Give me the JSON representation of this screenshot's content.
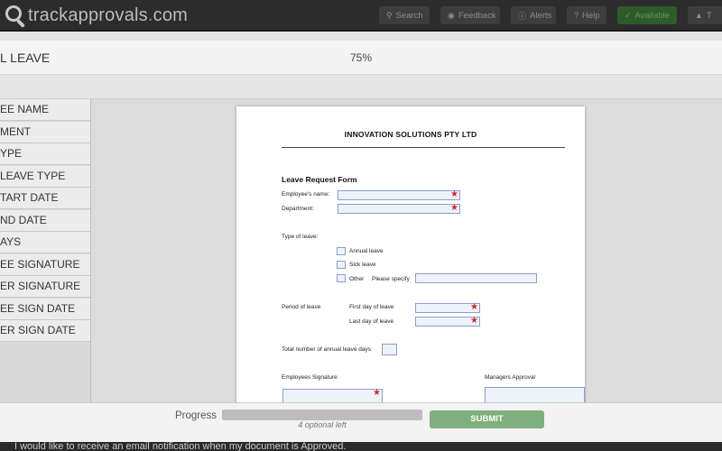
{
  "header": {
    "logo_text": "trackapprovals",
    "logo_suffix": ".com",
    "nav": [
      {
        "label": "Search",
        "icon": "search-icon"
      },
      {
        "label": "Feedback",
        "icon": "chat-icon"
      },
      {
        "label": "Alerts",
        "icon": "info-icon"
      },
      {
        "label": "Help",
        "icon": "help-icon"
      },
      {
        "label": "Available",
        "icon": "check-icon"
      },
      {
        "label": "T",
        "icon": "user-icon"
      }
    ]
  },
  "titlebar": {
    "title": "L LEAVE",
    "zoom": "75%"
  },
  "sidebar": {
    "items": [
      "EE NAME",
      "MENT",
      "YPE",
      "LEAVE TYPE",
      "TART DATE",
      "ND DATE",
      "AYS",
      "EE SIGNATURE",
      "ER SIGNATURE",
      "EE SIGN DATE",
      "ER SIGN DATE"
    ]
  },
  "document": {
    "company": "INNOVATION SOLUTIONS PTY LTD",
    "form_title": "Leave Request Form",
    "employee_name_label": "Employee's name:",
    "department_label": "Department:",
    "type_of_leave_label": "Type of leave:",
    "annual_leave": "Annual leave",
    "sick_leave": "Sick leave",
    "other": "Other",
    "please_specify": "Please specify",
    "period_label": "Period of leave",
    "first_day_label": "First day of leave",
    "last_day_label": "Last day of leave",
    "total_days_label": "Total number of annual leave days",
    "employee_signature_label": "Employees Signature",
    "managers_approval_label": "Managers Approval",
    "required_marker": "★"
  },
  "bottom": {
    "progress_label": "Progress",
    "progress_value": 0,
    "optional_left": "4 optional left",
    "submit_label": "SUBMIT",
    "notification_text": "I would like to receive an email notification when my document is Approved."
  },
  "colors": {
    "topbar": "#2c2c2c",
    "logo_accent": "#e8731a",
    "required": "#d12a2a",
    "field_border": "#8aa0c8",
    "submit": "#7faf7d"
  }
}
